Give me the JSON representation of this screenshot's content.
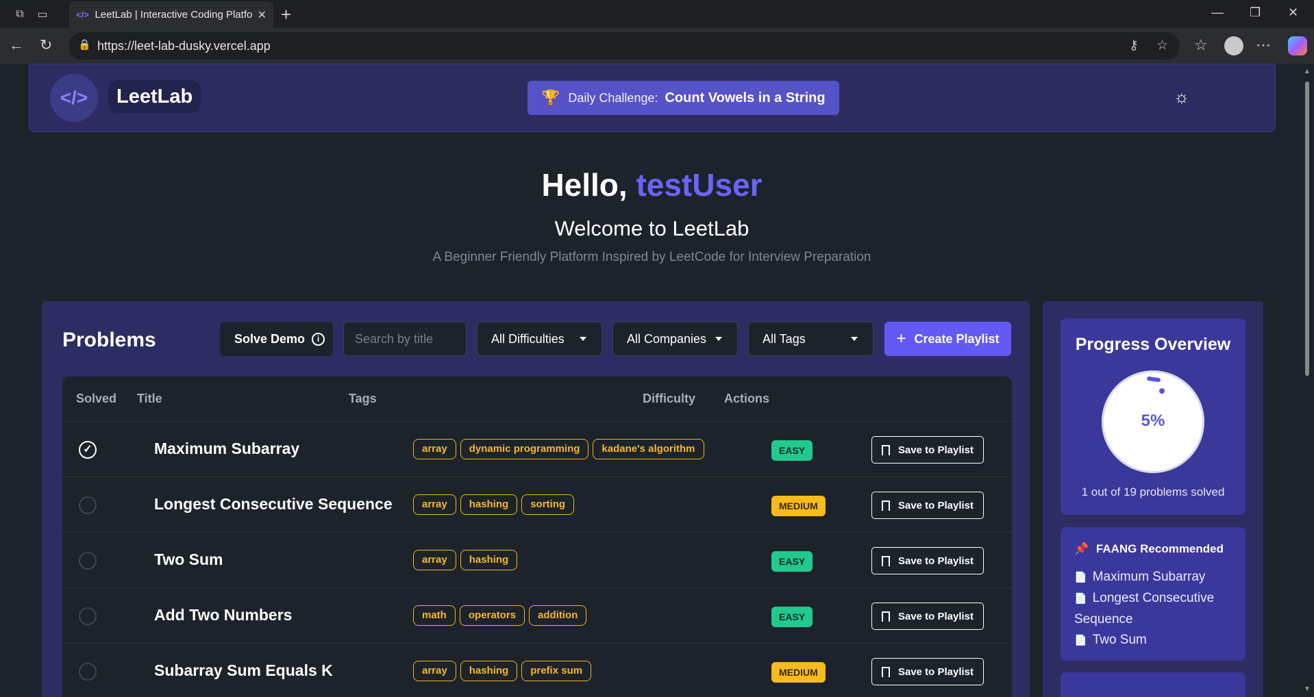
{
  "browser": {
    "tab_title": "LeetLab | Interactive Coding Platform",
    "url": "https://leet-lab-dusky.vercel.app"
  },
  "header": {
    "brand": "LeetLab",
    "daily_label": "Daily Challenge:",
    "daily_problem": "Count Vowels in a String"
  },
  "hero": {
    "greeting": "Hello,",
    "username": "testUser",
    "welcome": "Welcome to LeetLab",
    "tagline": "A Beginner Friendly Platform Inspired by LeetCode for Interview Preparation"
  },
  "problems": {
    "title": "Problems",
    "solve_demo": "Solve Demo",
    "search_placeholder": "Search by title",
    "filter_difficulty": "All Difficulties",
    "filter_company": "All Companies",
    "filter_tags": "All Tags",
    "create_playlist": "Create Playlist",
    "columns": [
      "Solved",
      "Title",
      "Tags",
      "Difficulty",
      "Actions"
    ],
    "save_label": "Save to Playlist",
    "rows": [
      {
        "solved": true,
        "title": "Maximum Subarray",
        "tags": [
          "array",
          "dynamic programming",
          "kadane's algorithm"
        ],
        "difficulty": "EASY"
      },
      {
        "solved": false,
        "title": "Longest Consecutive Sequence",
        "tags": [
          "array",
          "hashing",
          "sorting"
        ],
        "difficulty": "MEDIUM"
      },
      {
        "solved": false,
        "title": "Two Sum",
        "tags": [
          "array",
          "hashing"
        ],
        "difficulty": "EASY"
      },
      {
        "solved": false,
        "title": "Add Two Numbers",
        "tags": [
          "math",
          "operators",
          "addition"
        ],
        "difficulty": "EASY"
      },
      {
        "solved": false,
        "title": "Subarray Sum Equals K",
        "tags": [
          "array",
          "hashing",
          "prefix sum"
        ],
        "difficulty": "MEDIUM"
      }
    ]
  },
  "progress": {
    "title": "Progress Overview",
    "percent": "5%",
    "percent_value": 5,
    "caption": "1 out of 19 problems solved"
  },
  "faang": {
    "title": "FAANG Recommended",
    "items": [
      "Maximum Subarray",
      "Longest Consecutive Sequence",
      "Two Sum"
    ]
  },
  "colors": {
    "accent": "#6359f5",
    "header_bg": "#2c2c60",
    "panel_bg": "#2d2d63",
    "card_bg": "#3a389b",
    "easy": "#21c98f",
    "medium": "#f8bb1d",
    "tag": "#f2b61f"
  },
  "icons": {
    "logo": "code-icon",
    "daily": "trophy-icon",
    "theme": "sun-icon",
    "info": "info-icon",
    "create": "plus-icon",
    "save": "bookmark-icon",
    "faang": "pin-icon",
    "faang_item": "document-icon"
  }
}
